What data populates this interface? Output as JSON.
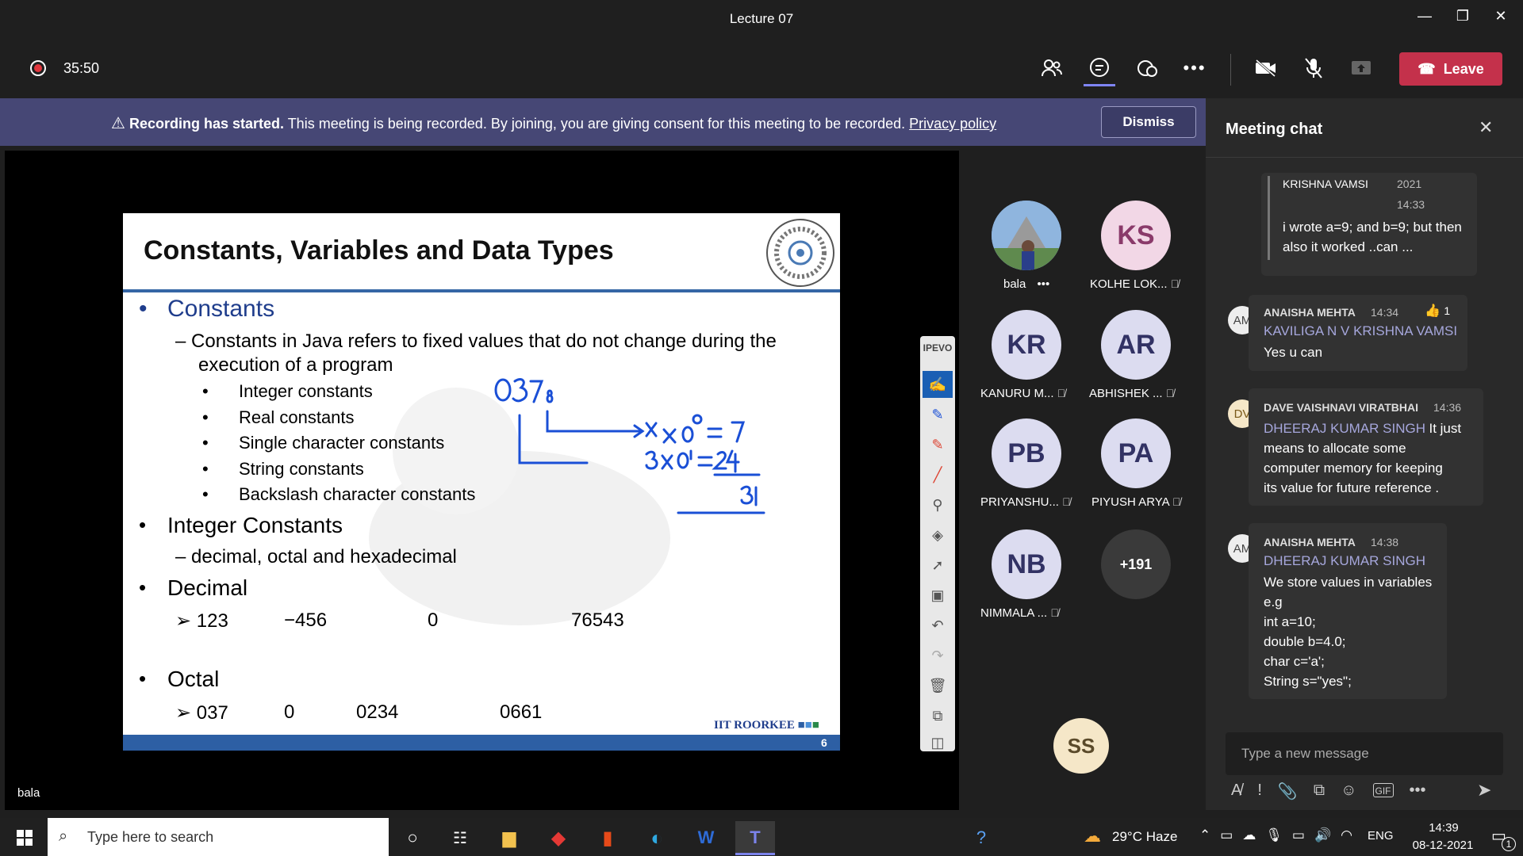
{
  "window": {
    "title": "Lecture 07"
  },
  "toolbar": {
    "timer": "35:50",
    "leave_label": "Leave"
  },
  "banner": {
    "bold": "Recording has started.",
    "text": "This meeting is being recorded. By joining, you are giving consent for this meeting to be recorded.",
    "link": "Privacy policy",
    "dismiss_label": "Dismiss"
  },
  "slide": {
    "title": "Constants, Variables and Data Types",
    "constants_heading": "Constants",
    "constants_desc_1": "– Constants in Java refers to fixed values that do not change during the",
    "constants_desc_2": "execution of a program",
    "constant_types": [
      "Integer constants",
      "Real constants",
      "Single character constants",
      "String constants",
      "Backslash character constants"
    ],
    "integer_heading": "Integer Constants",
    "integer_desc": "– decimal, octal and hexadecimal",
    "decimal_heading": "Decimal",
    "decimal_values": [
      "➢ 123",
      "−456",
      "0",
      "76543"
    ],
    "octal_heading": "Octal",
    "octal_values": [
      "➢ 037",
      "0",
      "0234",
      "0661"
    ],
    "footer_brand": "IIT ROORKEE",
    "page_number": "6",
    "tool_brand": "IPEVO"
  },
  "participants": [
    {
      "initials": "",
      "name": "bala",
      "photo": true
    },
    {
      "initials": "KS",
      "name": "KOLHE LOK..."
    },
    {
      "initials": "KR",
      "name": "KANURU M..."
    },
    {
      "initials": "AR",
      "name": "ABHISHEK ..."
    },
    {
      "initials": "PB",
      "name": "PRIYANSHU..."
    },
    {
      "initials": "PA",
      "name": "PIYUSH ARYA"
    },
    {
      "initials": "NB",
      "name": "NIMMALA ..."
    },
    {
      "initials": "+191",
      "name": ""
    }
  ],
  "self_tile": {
    "initials": "SS"
  },
  "stage_label": "bala",
  "chat": {
    "title": "Meeting chat",
    "quoted": {
      "name": "KRISHNA VAMSI",
      "year": "2021",
      "time": "14:33",
      "text": "i wrote a=9; and b=9; but then also it worked ..can ..."
    },
    "messages": [
      {
        "avatar": "AM",
        "name": "ANAISHA MEHTA",
        "time": "14:34",
        "reaction": "1",
        "mention": "KAVILIGA N V KRISHNA VAMSI",
        "body": [
          "Yes u can"
        ]
      },
      {
        "avatar": "DV",
        "name": "DAVE VAISHNAVI VIRATBHAI",
        "time": "14:36",
        "mention": "DHEERAJ KUMAR SINGH",
        "body_inline": "It just",
        "body": [
          "means to allocate some",
          "computer memory for keeping",
          "its value for future reference ."
        ]
      },
      {
        "avatar": "AM",
        "name": "ANAISHA MEHTA",
        "time": "14:38",
        "mention": "DHEERAJ KUMAR SINGH",
        "body": [
          "We store values in variables",
          "e.g",
          "int a=10;",
          "double b=4.0;",
          "char c='a';",
          "String s=\"yes\";"
        ]
      }
    ],
    "input_placeholder": "Type a new message"
  },
  "taskbar": {
    "search_placeholder": "Type here to search",
    "weather": "29°C  Haze",
    "lang": "ENG",
    "time": "14:39",
    "date": "08-12-2021",
    "notif_count": "1"
  },
  "colors": {
    "accent": "#464775",
    "leave": "#c4314b",
    "slide_blue": "#2d5fa4",
    "ink": "#1a4fd6"
  }
}
